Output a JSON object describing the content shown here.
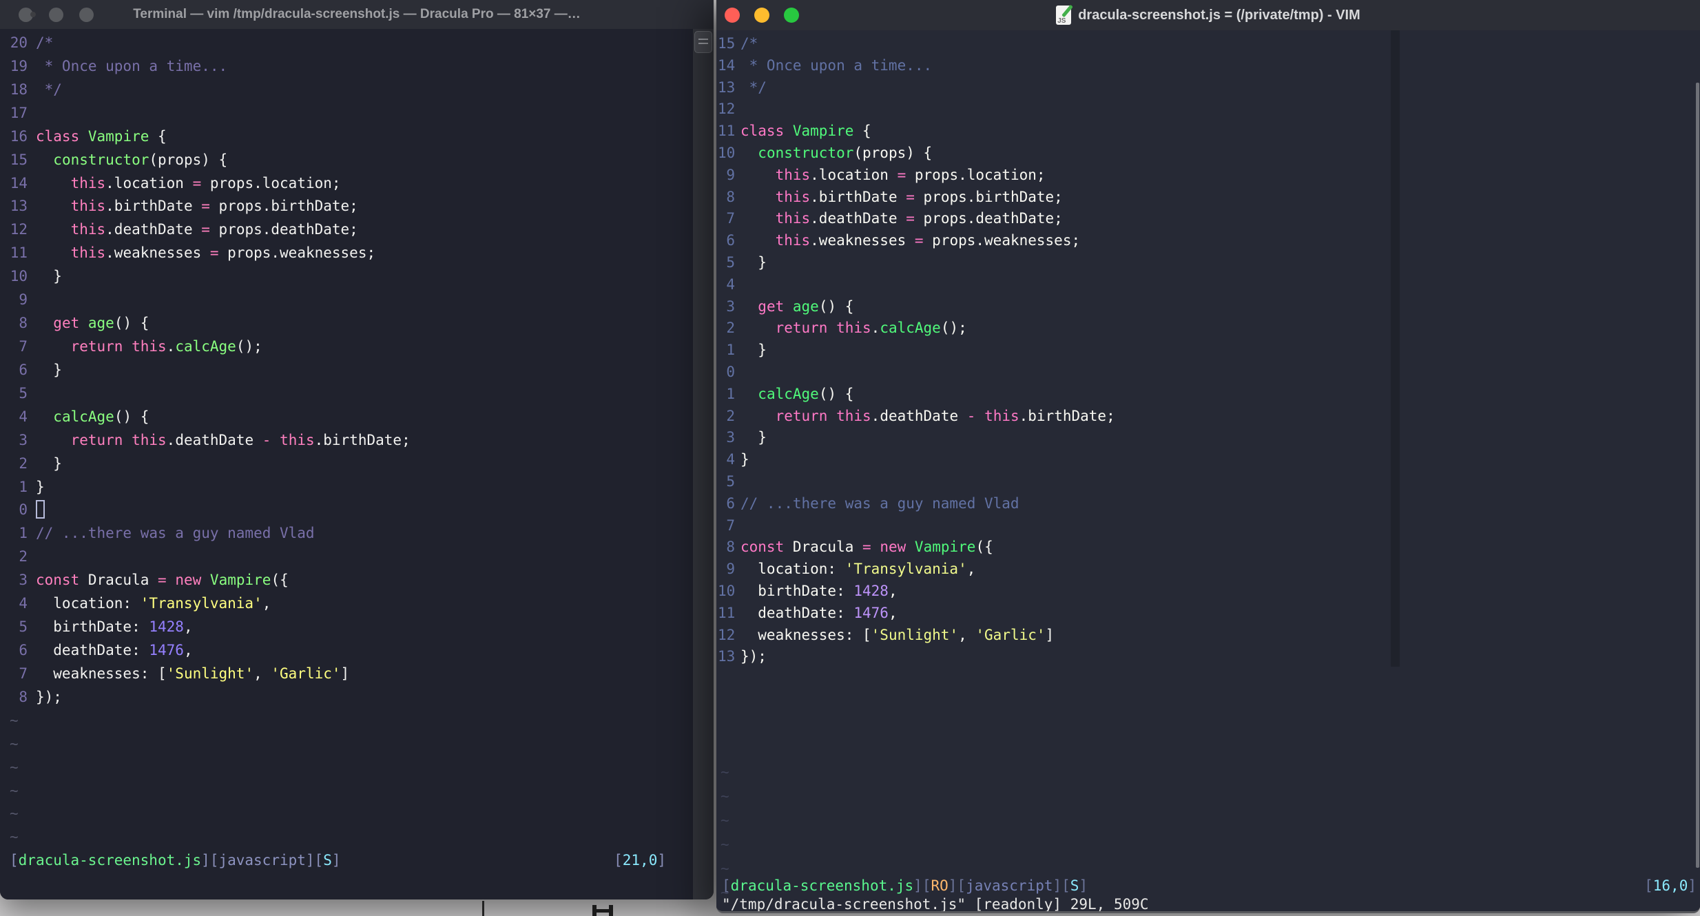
{
  "desktop": {
    "background_color": "#cfcecf"
  },
  "left_window": {
    "title": "Terminal — vim /tmp/dracula-screenshot.js — Dracula Pro — 81×37 —…",
    "theme_name": "Dracula Pro",
    "terminal_size": "81×37",
    "palette": {
      "bg": "#20222d",
      "w": "#F2F2F0",
      "c": "#7970A9",
      "p": "#FF80BF",
      "g": "#8AFF80",
      "y": "#FFFF80",
      "u": "#9580FF",
      "o": "#FFCA80",
      "cy": "#8BE9FD",
      "br": "#8A8FB8",
      "fn": "#6BF58E",
      "lav": "#8D93C0",
      "num": "#7970A9",
      "tilde": "#54566a",
      "cursor": "#B7BCDB"
    },
    "tildes": {
      "count": 6,
      "char": "~"
    },
    "status_segs": [
      [
        "br",
        "["
      ],
      [
        "fn",
        "dracula-screenshot.js"
      ],
      [
        "br",
        "]["
      ],
      [
        "lav",
        "javascript"
      ],
      [
        "br",
        "]["
      ],
      [
        "cy",
        "S"
      ],
      [
        "br",
        "]"
      ]
    ],
    "ruler_segs": [
      [
        "br",
        "["
      ],
      [
        "cy",
        "21,0"
      ],
      [
        "br",
        "]"
      ]
    ],
    "lines": [
      {
        "n": "20",
        "s": [
          [
            "c",
            "/*"
          ]
        ]
      },
      {
        "n": "19",
        "s": [
          [
            "c",
            " * Once upon a time..."
          ]
        ]
      },
      {
        "n": "18",
        "s": [
          [
            "c",
            " */"
          ]
        ]
      },
      {
        "n": "17",
        "s": []
      },
      {
        "n": "16",
        "s": [
          [
            "p",
            "class"
          ],
          [
            "w",
            " "
          ],
          [
            "g",
            "Vampire"
          ],
          [
            "w",
            " {"
          ]
        ]
      },
      {
        "n": "15",
        "s": [
          [
            "w",
            "  "
          ],
          [
            "g",
            "constructor"
          ],
          [
            "w",
            "(props) {"
          ]
        ]
      },
      {
        "n": "14",
        "s": [
          [
            "w",
            "    "
          ],
          [
            "p",
            "this"
          ],
          [
            "w",
            ".location "
          ],
          [
            "p",
            "="
          ],
          [
            "w",
            " props.location;"
          ]
        ]
      },
      {
        "n": "13",
        "s": [
          [
            "w",
            "    "
          ],
          [
            "p",
            "this"
          ],
          [
            "w",
            ".birthDate "
          ],
          [
            "p",
            "="
          ],
          [
            "w",
            " props.birthDate;"
          ]
        ]
      },
      {
        "n": "12",
        "s": [
          [
            "w",
            "    "
          ],
          [
            "p",
            "this"
          ],
          [
            "w",
            ".deathDate "
          ],
          [
            "p",
            "="
          ],
          [
            "w",
            " props.deathDate;"
          ]
        ]
      },
      {
        "n": "11",
        "s": [
          [
            "w",
            "    "
          ],
          [
            "p",
            "this"
          ],
          [
            "w",
            ".weaknesses "
          ],
          [
            "p",
            "="
          ],
          [
            "w",
            " props.weaknesses;"
          ]
        ]
      },
      {
        "n": "10",
        "s": [
          [
            "w",
            "  }"
          ]
        ]
      },
      {
        "n": "9",
        "s": []
      },
      {
        "n": "8",
        "s": [
          [
            "w",
            "  "
          ],
          [
            "p",
            "get"
          ],
          [
            "w",
            " "
          ],
          [
            "g",
            "age"
          ],
          [
            "w",
            "() {"
          ]
        ]
      },
      {
        "n": "7",
        "s": [
          [
            "w",
            "    "
          ],
          [
            "p",
            "return"
          ],
          [
            "w",
            " "
          ],
          [
            "p",
            "this"
          ],
          [
            "w",
            "."
          ],
          [
            "g",
            "calcAge"
          ],
          [
            "w",
            "();"
          ]
        ]
      },
      {
        "n": "6",
        "s": [
          [
            "w",
            "  }"
          ]
        ]
      },
      {
        "n": "5",
        "s": []
      },
      {
        "n": "4",
        "s": [
          [
            "w",
            "  "
          ],
          [
            "g",
            "calcAge"
          ],
          [
            "w",
            "() {"
          ]
        ]
      },
      {
        "n": "3",
        "s": [
          [
            "w",
            "    "
          ],
          [
            "p",
            "return"
          ],
          [
            "w",
            " "
          ],
          [
            "p",
            "this"
          ],
          [
            "w",
            ".deathDate "
          ],
          [
            "p",
            "-"
          ],
          [
            "w",
            " "
          ],
          [
            "p",
            "this"
          ],
          [
            "w",
            ".birthDate;"
          ]
        ]
      },
      {
        "n": "2",
        "s": [
          [
            "w",
            "  }"
          ]
        ]
      },
      {
        "n": "1",
        "s": [
          [
            "w",
            "}"
          ]
        ]
      },
      {
        "n": "0",
        "cursor": true,
        "s": []
      },
      {
        "n": "1",
        "s": [
          [
            "c",
            "// ...there was a guy named Vlad"
          ]
        ]
      },
      {
        "n": "2",
        "s": []
      },
      {
        "n": "3",
        "s": [
          [
            "p",
            "const"
          ],
          [
            "w",
            " Dracula "
          ],
          [
            "p",
            "="
          ],
          [
            "w",
            " "
          ],
          [
            "p",
            "new"
          ],
          [
            "w",
            " "
          ],
          [
            "g",
            "Vampire"
          ],
          [
            "w",
            "({"
          ]
        ]
      },
      {
        "n": "4",
        "s": [
          [
            "w",
            "  location: "
          ],
          [
            "y",
            "'Transylvania'"
          ],
          [
            "w",
            ","
          ]
        ]
      },
      {
        "n": "5",
        "s": [
          [
            "w",
            "  birthDate: "
          ],
          [
            "u",
            "1428"
          ],
          [
            "w",
            ","
          ]
        ]
      },
      {
        "n": "6",
        "s": [
          [
            "w",
            "  deathDate: "
          ],
          [
            "u",
            "1476"
          ],
          [
            "w",
            ","
          ]
        ]
      },
      {
        "n": "7",
        "s": [
          [
            "w",
            "  weaknesses: ["
          ],
          [
            "y",
            "'Sunlight'"
          ],
          [
            "w",
            ", "
          ],
          [
            "y",
            "'Garlic'"
          ],
          [
            "w",
            "]"
          ]
        ]
      },
      {
        "n": "8",
        "s": [
          [
            "w",
            "});"
          ]
        ]
      }
    ]
  },
  "right_window": {
    "title": "dracula-screenshot.js = (/private/tmp) - VIM",
    "file_icon_label": "JS",
    "cmdline": "\"/tmp/dracula-screenshot.js\" [readonly] 29L, 509C",
    "palette": {
      "bg": "#262935",
      "w": "#F8F8F2",
      "c": "#6272A4",
      "p": "#FF79C6",
      "g": "#50FA7B",
      "y": "#F1FA8C",
      "u": "#BD93F9",
      "o": "#FFB86C",
      "cy": "#8BE9FD",
      "br": "#6B7499",
      "fn": "#5AF78E",
      "lav": "#7681B5",
      "num": "#6272A4",
      "tilde": "#3E4257",
      "cursor": "#B7BCDB"
    },
    "tildes": {
      "count": 6,
      "char": "~"
    },
    "status_segs": [
      [
        "br",
        "["
      ],
      [
        "fn",
        "dracula-screenshot.js"
      ],
      [
        "br",
        "]["
      ],
      [
        "o",
        "RO"
      ],
      [
        "br",
        "]["
      ],
      [
        "lav",
        "javascript"
      ],
      [
        "br",
        "]["
      ],
      [
        "cy",
        "S"
      ],
      [
        "br",
        "]"
      ]
    ],
    "ruler_segs": [
      [
        "br",
        "["
      ],
      [
        "cy",
        "16,0"
      ],
      [
        "br",
        "]"
      ]
    ],
    "lines": [
      {
        "n": "15",
        "s": [
          [
            "c",
            "/*"
          ]
        ]
      },
      {
        "n": "14",
        "s": [
          [
            "c",
            " * Once upon a time..."
          ]
        ]
      },
      {
        "n": "13",
        "s": [
          [
            "c",
            " */"
          ]
        ]
      },
      {
        "n": "12",
        "s": []
      },
      {
        "n": "11",
        "s": [
          [
            "p",
            "class"
          ],
          [
            "w",
            " "
          ],
          [
            "g",
            "Vampire"
          ],
          [
            "w",
            " {"
          ]
        ]
      },
      {
        "n": "10",
        "s": [
          [
            "w",
            "  "
          ],
          [
            "g",
            "constructor"
          ],
          [
            "w",
            "(props) {"
          ]
        ]
      },
      {
        "n": "9",
        "s": [
          [
            "w",
            "    "
          ],
          [
            "p",
            "this"
          ],
          [
            "w",
            ".location "
          ],
          [
            "p",
            "="
          ],
          [
            "w",
            " props.location;"
          ]
        ]
      },
      {
        "n": "8",
        "s": [
          [
            "w",
            "    "
          ],
          [
            "p",
            "this"
          ],
          [
            "w",
            ".birthDate "
          ],
          [
            "p",
            "="
          ],
          [
            "w",
            " props.birthDate;"
          ]
        ]
      },
      {
        "n": "7",
        "s": [
          [
            "w",
            "    "
          ],
          [
            "p",
            "this"
          ],
          [
            "w",
            ".deathDate "
          ],
          [
            "p",
            "="
          ],
          [
            "w",
            " props.deathDate;"
          ]
        ]
      },
      {
        "n": "6",
        "s": [
          [
            "w",
            "    "
          ],
          [
            "p",
            "this"
          ],
          [
            "w",
            ".weaknesses "
          ],
          [
            "p",
            "="
          ],
          [
            "w",
            " props.weaknesses;"
          ]
        ]
      },
      {
        "n": "5",
        "s": [
          [
            "w",
            "  }"
          ]
        ]
      },
      {
        "n": "4",
        "s": []
      },
      {
        "n": "3",
        "s": [
          [
            "w",
            "  "
          ],
          [
            "p",
            "get"
          ],
          [
            "w",
            " "
          ],
          [
            "g",
            "age"
          ],
          [
            "w",
            "() {"
          ]
        ]
      },
      {
        "n": "2",
        "s": [
          [
            "w",
            "    "
          ],
          [
            "p",
            "return"
          ],
          [
            "w",
            " "
          ],
          [
            "p",
            "this"
          ],
          [
            "w",
            "."
          ],
          [
            "g",
            "calcAge"
          ],
          [
            "w",
            "();"
          ]
        ]
      },
      {
        "n": "1",
        "s": [
          [
            "w",
            "  }"
          ]
        ]
      },
      {
        "n": "0",
        "s": []
      },
      {
        "n": "1",
        "s": [
          [
            "w",
            "  "
          ],
          [
            "g",
            "calcAge"
          ],
          [
            "w",
            "() {"
          ]
        ]
      },
      {
        "n": "2",
        "s": [
          [
            "w",
            "    "
          ],
          [
            "p",
            "return"
          ],
          [
            "w",
            " "
          ],
          [
            "p",
            "this"
          ],
          [
            "w",
            ".deathDate "
          ],
          [
            "p",
            "-"
          ],
          [
            "w",
            " "
          ],
          [
            "p",
            "this"
          ],
          [
            "w",
            ".birthDate;"
          ]
        ]
      },
      {
        "n": "3",
        "s": [
          [
            "w",
            "  }"
          ]
        ]
      },
      {
        "n": "4",
        "s": [
          [
            "w",
            "}"
          ]
        ]
      },
      {
        "n": "5",
        "s": []
      },
      {
        "n": "6",
        "s": [
          [
            "c",
            "// ...there was a guy named Vlad"
          ]
        ]
      },
      {
        "n": "7",
        "s": []
      },
      {
        "n": "8",
        "s": [
          [
            "p",
            "const"
          ],
          [
            "w",
            " Dracula "
          ],
          [
            "p",
            "="
          ],
          [
            "w",
            " "
          ],
          [
            "p",
            "new"
          ],
          [
            "w",
            " "
          ],
          [
            "g",
            "Vampire"
          ],
          [
            "w",
            "({"
          ]
        ]
      },
      {
        "n": "9",
        "s": [
          [
            "w",
            "  location: "
          ],
          [
            "y",
            "'Transylvania'"
          ],
          [
            "w",
            ","
          ]
        ]
      },
      {
        "n": "10",
        "s": [
          [
            "w",
            "  birthDate: "
          ],
          [
            "u",
            "1428"
          ],
          [
            "w",
            ","
          ]
        ]
      },
      {
        "n": "11",
        "s": [
          [
            "w",
            "  deathDate: "
          ],
          [
            "u",
            "1476"
          ],
          [
            "w",
            ","
          ]
        ]
      },
      {
        "n": "12",
        "s": [
          [
            "w",
            "  weaknesses: ["
          ],
          [
            "y",
            "'Sunlight'"
          ],
          [
            "w",
            ", "
          ],
          [
            "y",
            "'Garlic'"
          ],
          [
            "w",
            "]"
          ]
        ]
      },
      {
        "n": "13",
        "s": [
          [
            "w",
            "});"
          ]
        ]
      }
    ]
  }
}
